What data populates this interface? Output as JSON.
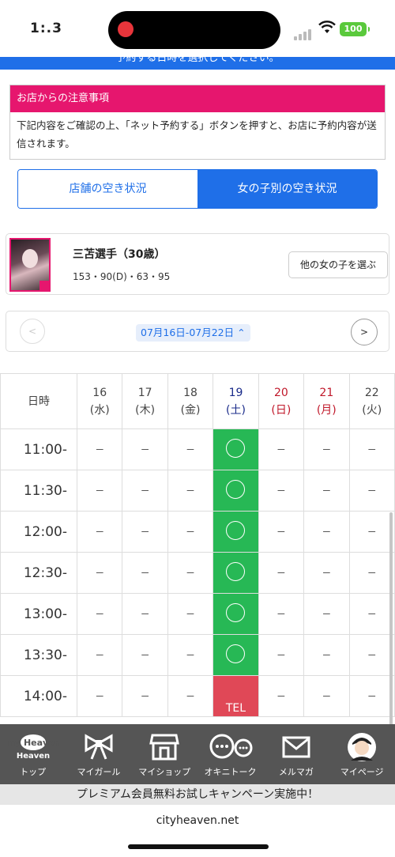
{
  "status": {
    "time": "1:.3",
    "battery": "100"
  },
  "top_strip": "予約する日時を選択してください。",
  "notice": {
    "title": "お店からの注意事項",
    "body": "下記内容をご確認の上、「ネット予約する」ボタンを押すと、お店に予約内容が送信されます。"
  },
  "toggle": {
    "shop": "店舗の空き状況",
    "girl": "女の子別の空き状況"
  },
  "girl": {
    "name": "三苫選手（30歳）",
    "spec": "153・90(D)・63・95",
    "other_button": "他の女の子を選ぶ"
  },
  "week": {
    "range": "07月16日-07月22日",
    "prev": "<",
    "next": ">"
  },
  "schedule": {
    "corner": "日時",
    "days": [
      {
        "d": "16",
        "w": "(水)",
        "kind": "wk"
      },
      {
        "d": "17",
        "w": "(木)",
        "kind": "wk"
      },
      {
        "d": "18",
        "w": "(金)",
        "kind": "wk"
      },
      {
        "d": "19",
        "w": "(土)",
        "kind": "sat"
      },
      {
        "d": "20",
        "w": "(日)",
        "kind": "sun"
      },
      {
        "d": "21",
        "w": "(月)",
        "kind": "sun"
      },
      {
        "d": "22",
        "w": "(火)",
        "kind": "wk"
      }
    ],
    "rows": [
      {
        "time": "11:00-",
        "cells": [
          "－",
          "－",
          "－",
          "ok",
          "－",
          "－",
          "－"
        ]
      },
      {
        "time": "11:30-",
        "cells": [
          "－",
          "－",
          "－",
          "ok",
          "－",
          "－",
          "－"
        ]
      },
      {
        "time": "12:00-",
        "cells": [
          "－",
          "－",
          "－",
          "ok",
          "－",
          "－",
          "－"
        ]
      },
      {
        "time": "12:30-",
        "cells": [
          "－",
          "－",
          "－",
          "ok",
          "－",
          "－",
          "－"
        ]
      },
      {
        "time": "13:00-",
        "cells": [
          "－",
          "－",
          "－",
          "ok",
          "－",
          "－",
          "－"
        ]
      },
      {
        "time": "13:30-",
        "cells": [
          "－",
          "－",
          "－",
          "ok",
          "－",
          "－",
          "－"
        ]
      },
      {
        "time": "14:00-",
        "cells": [
          "－",
          "－",
          "－",
          "TEL",
          "－",
          "－",
          "－"
        ]
      }
    ]
  },
  "nav": [
    {
      "label": "トップ",
      "icon": "my-heaven-logo-icon",
      "logo_text": "my Heaven"
    },
    {
      "label": "マイガール",
      "icon": "ribbon-icon"
    },
    {
      "label": "マイショップ",
      "icon": "shop-icon"
    },
    {
      "label": "オキニトーク",
      "icon": "chat-icon"
    },
    {
      "label": "メルマガ",
      "icon": "mail-icon"
    },
    {
      "label": "マイページ",
      "icon": "avatar-icon"
    }
  ],
  "premium_banner": "プレミアム会員無料お試しキャンペーン実施中！",
  "url": "cityheaven.net",
  "colors": {
    "accent_blue": "#1f6fe8",
    "notice_pink": "#e6166e",
    "available_green": "#27b855",
    "tel_red": "#e04857"
  }
}
